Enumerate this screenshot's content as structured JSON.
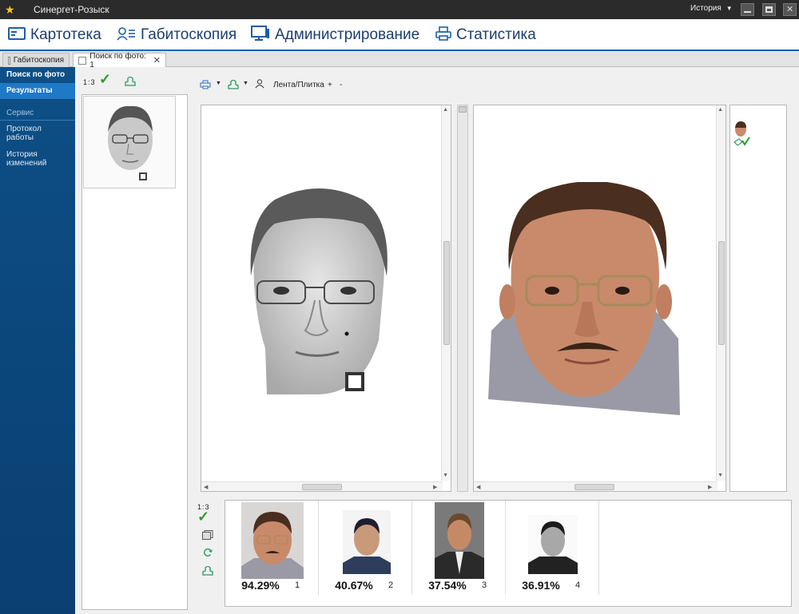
{
  "window": {
    "title": "Синергет-Розыск",
    "history_label": "История"
  },
  "menu": [
    {
      "label": "Картотека",
      "icon": "card-index-icon"
    },
    {
      "label": "Габитоскопия",
      "icon": "faces-icon"
    },
    {
      "label": "Администрирование",
      "icon": "monitor-icon"
    },
    {
      "label": "Статистика",
      "icon": "printer-icon"
    }
  ],
  "tabs": [
    {
      "label": "Габитоскопия"
    },
    {
      "label": "Поиск по фото: 1"
    }
  ],
  "sidebar": {
    "items": [
      {
        "label": "Поиск по фото"
      },
      {
        "label": "Результаты"
      }
    ],
    "section": "Сервис",
    "links": [
      {
        "label": "Протокол работы"
      },
      {
        "label": "История изменений"
      }
    ]
  },
  "query": {
    "ratio": "1:3"
  },
  "toolbar": {
    "view_label": "Лента/Плитка",
    "plus": "+",
    "minus": "-"
  },
  "results": {
    "ratio": "1:3",
    "items": [
      {
        "percent": "94.29%",
        "rank": "1"
      },
      {
        "percent": "40.67%",
        "rank": "2"
      },
      {
        "percent": "37.54%",
        "rank": "3"
      },
      {
        "percent": "36.91%",
        "rank": "4"
      }
    ]
  }
}
